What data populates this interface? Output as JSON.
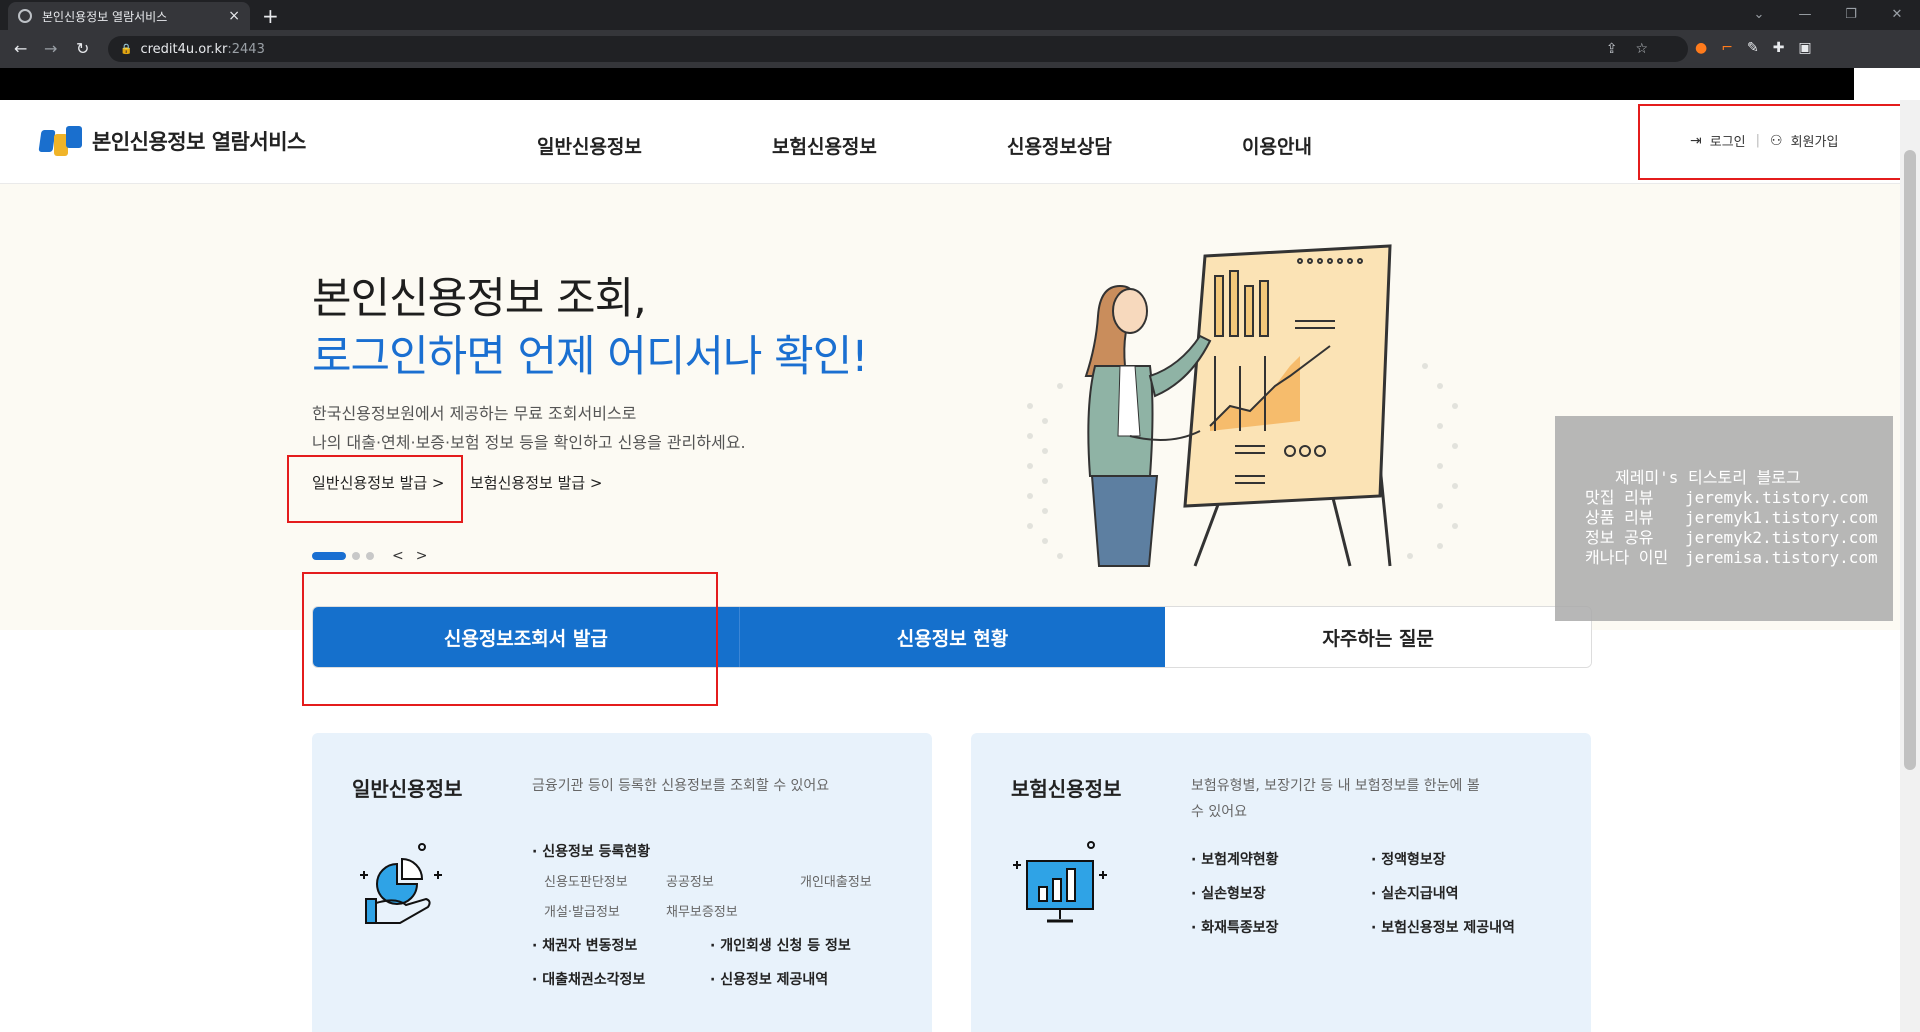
{
  "browser": {
    "tab_title": "본인신용정보 열람서비스",
    "tab_close": "×",
    "new_tab": "+",
    "url_host": "credit4u.or.kr",
    "url_port": ":2443",
    "window_controls": [
      "⌄",
      "—",
      "❐",
      "✕"
    ]
  },
  "header": {
    "logo_text": "본인신용정보 열람서비스",
    "nav": [
      "일반신용정보",
      "보험신용정보",
      "신용정보상담",
      "이용안내"
    ],
    "login": "로그인",
    "signup": "회원가입",
    "separator": "|"
  },
  "hero": {
    "title_line1": "본인신용정보 조회,",
    "title_line2": "로그인하면 언제 어디서나 확인!",
    "desc_line1": "한국신용정보원에서 제공하는 무료 조회서비스로",
    "desc_line2": "나의 대출·연체·보증·보험 정보 등을 확인하고 신용을 관리하세요.",
    "link1": "일반신용정보 발급 >",
    "link2": "보험신용정보 발급 >",
    "slide_count": 3,
    "slide_active": 1
  },
  "quick_tabs": [
    "신용정보조회서 발급",
    "신용정보 현황",
    "자주하는 질문"
  ],
  "cards": {
    "general": {
      "title": "일반신용정보",
      "desc": "금융기관 등이 등록한 신용정보를 조회할 수 있어요",
      "heading": "· 신용정보 등록현황",
      "sub_items": [
        "신용도판단정보",
        "공공정보",
        "개인대출정보",
        "개설·발급정보",
        "채무보증정보"
      ],
      "items": [
        "· 채권자 변동정보",
        "· 개인회생 신청 등 정보",
        "· 대출채권소각정보",
        "· 신용정보 제공내역"
      ]
    },
    "insurance": {
      "title": "보험신용정보",
      "desc": "보험유형별, 보장기간 등 내 보험정보를 한눈에 볼 수 있어요",
      "items": [
        "· 보험계약현황",
        "· 정액형보장",
        "· 실손형보장",
        "· 실손지급내역",
        "· 화재특종보장",
        "· 보험신용정보 제공내역"
      ]
    }
  },
  "watermark": {
    "title": "제레미's 티스토리 블로그",
    "rows": [
      {
        "k": "맛집 리뷰",
        "v": "jeremyk.tistory.com"
      },
      {
        "k": "상품 리뷰",
        "v": "jeremyk1.tistory.com"
      },
      {
        "k": "정보 공유",
        "v": "jeremyk2.tistory.com"
      },
      {
        "k": "캐나다 이민",
        "v": "jeremisa.tistory.com"
      }
    ]
  },
  "colors": {
    "accent": "#1a6fd1",
    "tab_blue": "#1570cc",
    "hero_bg": "#fcfaf3",
    "card_bg": "#e8f2fb",
    "highlight_red": "#e41c1c"
  }
}
